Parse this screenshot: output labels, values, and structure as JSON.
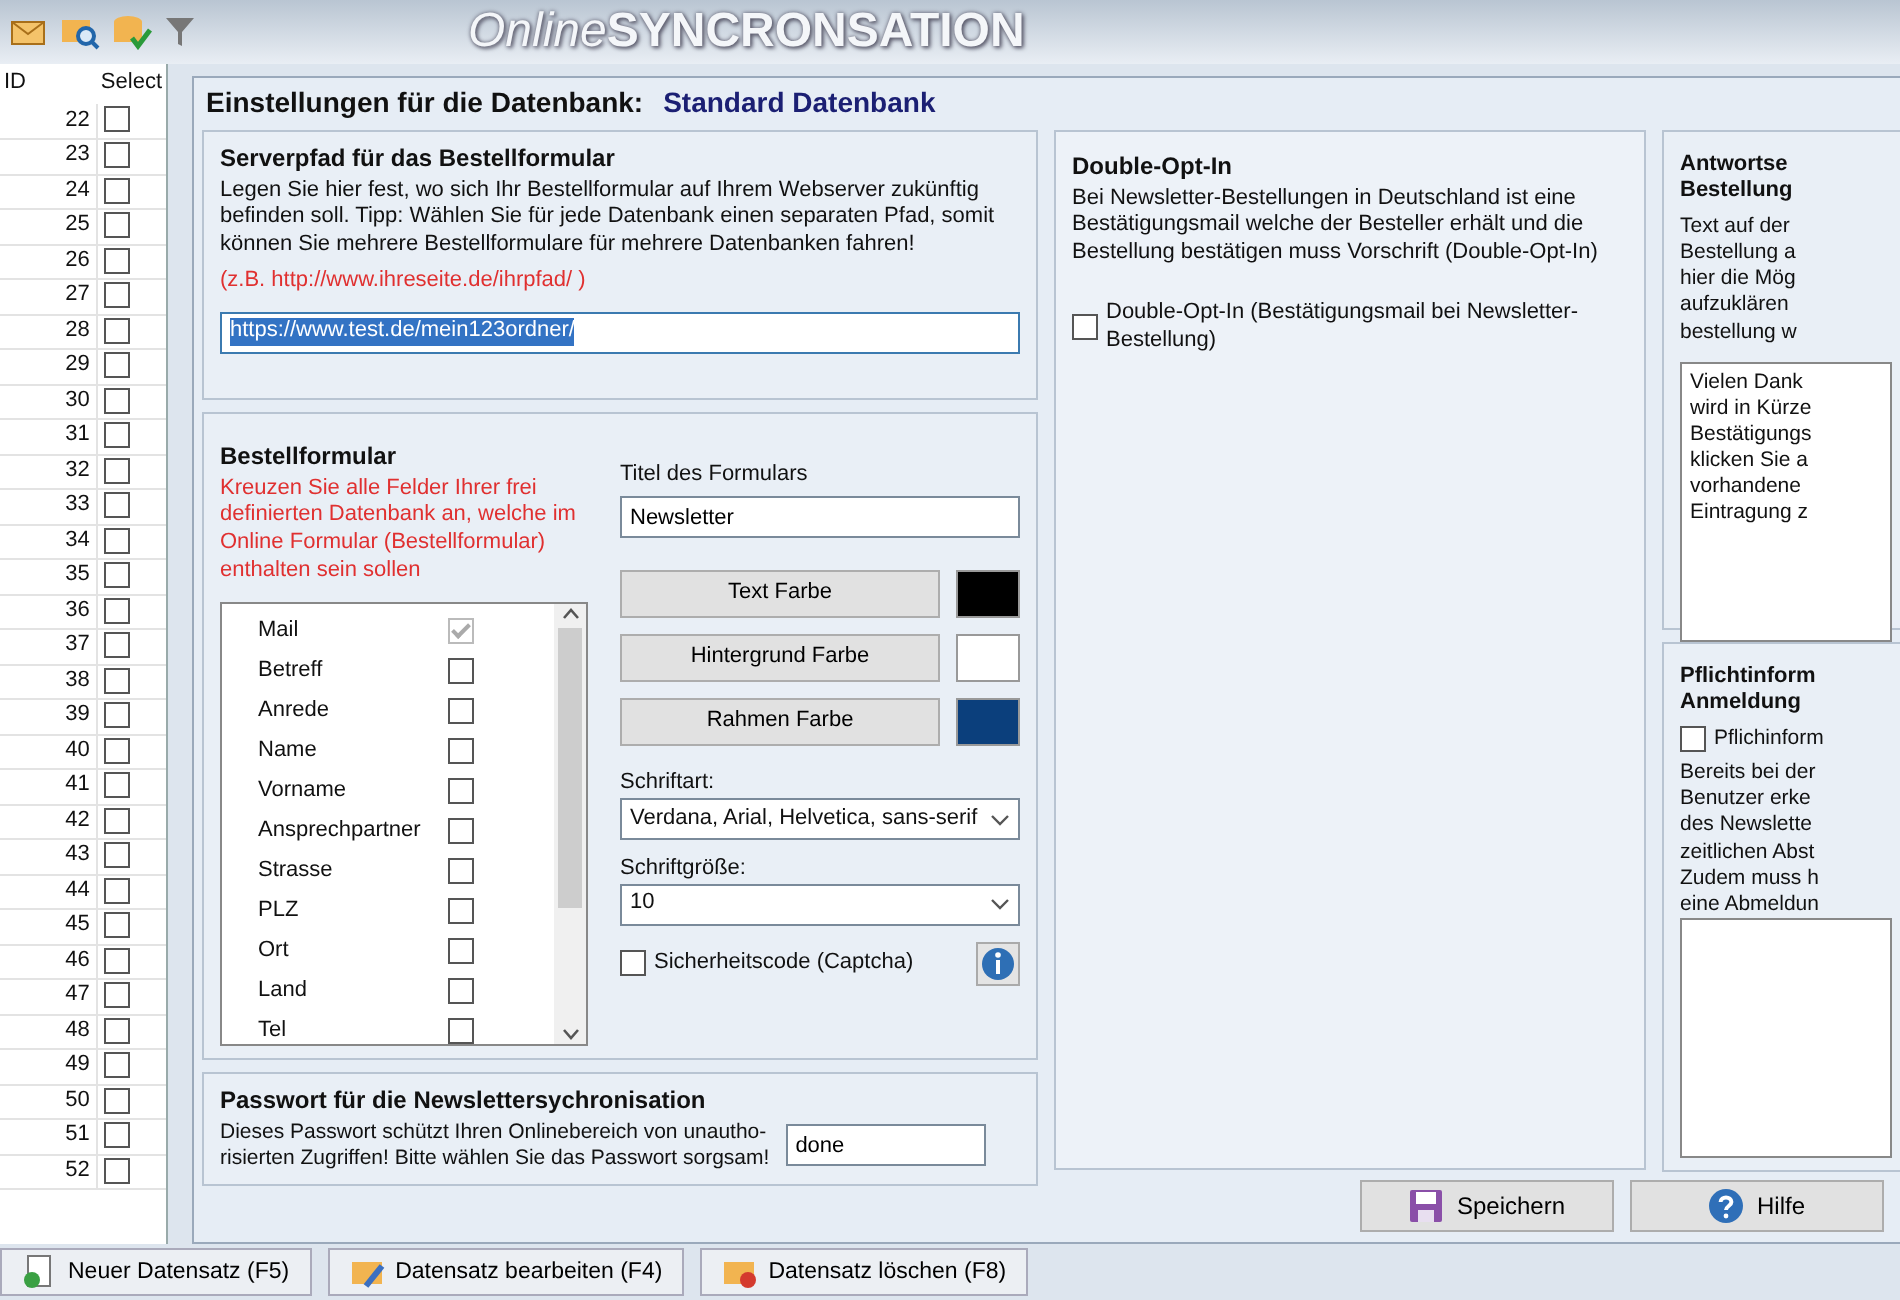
{
  "banner": {
    "logo_parts": [
      "Online",
      "SYNCRONSATION"
    ]
  },
  "records_table": {
    "columns": [
      "ID",
      "Select"
    ],
    "rows": [
      {
        "id": "22",
        "checked": false
      },
      {
        "id": "23",
        "checked": false
      },
      {
        "id": "24",
        "checked": false
      },
      {
        "id": "25",
        "checked": false
      },
      {
        "id": "26",
        "checked": false
      },
      {
        "id": "27",
        "checked": false
      },
      {
        "id": "28",
        "checked": false
      },
      {
        "id": "29",
        "checked": false
      },
      {
        "id": "30",
        "checked": false
      },
      {
        "id": "31",
        "checked": false
      },
      {
        "id": "32",
        "checked": false
      },
      {
        "id": "33",
        "checked": false
      },
      {
        "id": "34",
        "checked": false
      },
      {
        "id": "35",
        "checked": false
      },
      {
        "id": "36",
        "checked": false
      },
      {
        "id": "37",
        "checked": false
      },
      {
        "id": "38",
        "checked": false
      },
      {
        "id": "39",
        "checked": false
      },
      {
        "id": "40",
        "checked": false
      },
      {
        "id": "41",
        "checked": false
      },
      {
        "id": "42",
        "checked": false
      },
      {
        "id": "43",
        "checked": false
      },
      {
        "id": "44",
        "checked": false
      },
      {
        "id": "45",
        "checked": false
      },
      {
        "id": "46",
        "checked": false
      },
      {
        "id": "47",
        "checked": false
      },
      {
        "id": "48",
        "checked": false
      },
      {
        "id": "49",
        "checked": false
      },
      {
        "id": "50",
        "checked": false
      },
      {
        "id": "51",
        "checked": false
      },
      {
        "id": "52",
        "checked": false
      }
    ]
  },
  "dialog": {
    "title": "Einstellungen für die Datenbank:",
    "database": "Standard Datenbank",
    "server_path": {
      "heading": "Serverpfad für das Bestellformular",
      "description": "Legen Sie hier fest, wo sich Ihr Bestellformular auf Ihrem Webserver zukünftig befinden soll. Tipp: Wählen Sie für jede Datenbank einen separaten Pfad, somit können Sie mehrere Bestellformulare für mehrere Datenbanken fahren!",
      "example": "(z.B.  http://www.ihreseite.de/ihrpfad/ )",
      "value": "https://www.test.de/mein123ordner/",
      "text_selected": true
    },
    "order_form": {
      "heading": "Bestellformular",
      "instruction": "Kreuzen Sie alle Felder Ihrer frei definierten Datenbank an, welche im Online Formular (Bestellformular) enthalten sein sollen",
      "fields": [
        {
          "label": "Mail",
          "checked": true,
          "disabled": true
        },
        {
          "label": "Betreff",
          "checked": false,
          "disabled": false
        },
        {
          "label": "Anrede",
          "checked": false,
          "disabled": false
        },
        {
          "label": "Name",
          "checked": false,
          "disabled": false
        },
        {
          "label": "Vorname",
          "checked": false,
          "disabled": false
        },
        {
          "label": "Ansprechpartner",
          "checked": false,
          "disabled": false
        },
        {
          "label": "Strasse",
          "checked": false,
          "disabled": false
        },
        {
          "label": "PLZ",
          "checked": false,
          "disabled": false
        },
        {
          "label": "Ort",
          "checked": false,
          "disabled": false
        },
        {
          "label": "Land",
          "checked": false,
          "disabled": false
        },
        {
          "label": "Tel",
          "checked": false,
          "disabled": false
        }
      ],
      "form_title_label": "Titel des Formulars",
      "form_title_value": "Newsletter",
      "color_buttons": [
        {
          "label": "Text Farbe",
          "color": "#000000"
        },
        {
          "label": "Hintergrund Farbe",
          "color": "#ffffff"
        },
        {
          "label": "Rahmen Farbe",
          "color": "#0b3f7c"
        }
      ],
      "font_label": "Schriftart:",
      "font_value": "Verdana, Arial, Helvetica, sans-serif",
      "size_label": "Schriftgröße:",
      "size_value": "10",
      "captcha": {
        "label": "Sicherheitscode (Captcha)",
        "checked": false
      }
    },
    "password": {
      "heading": "Passwort für die Newslettersychronisation",
      "lines": [
        "Dieses Passwort schützt Ihren Onlinebereich von unautho-",
        "risierten Zugriffen! Bitte wählen Sie das Passwort sorgsam!"
      ],
      "value": "done"
    },
    "double_opt_in": {
      "heading": "Double-Opt-In",
      "lines": [
        "Bei Newsletter-Bestellungen in Deutschland ist eine",
        "Bestätigungsmail welche der Besteller erhält und die",
        "Bestellung bestätigen muss Vorschrift  (Double-Opt-In)"
      ],
      "checkbox": {
        "label": "Double-Opt-In (Bestätigungsmail bei Newsletter-Bestellung)",
        "checked": false
      }
    },
    "reply_page": {
      "heading_lines": [
        "Antwortse",
        "Bestellung"
      ],
      "description_lines": [
        "Text auf der",
        "Bestellung a",
        "hier die Mög",
        "aufzuklären",
        "bestellung w"
      ],
      "text_lines": [
        "Vielen Dank",
        "wird in Kürze",
        "Bestätigungs",
        "klicken Sie a",
        "vorhandene",
        "Eintragung z"
      ]
    },
    "mandatory_info": {
      "heading_lines": [
        "Pflichtinform",
        "Anmeldung"
      ],
      "checkbox": {
        "label": "Pflichinform",
        "checked": false
      },
      "description_lines": [
        "Bereits bei der",
        "Benutzer erke",
        "des Newslette",
        "zeitlichen Abst",
        "Zudem muss h",
        "eine Abmeldun"
      ]
    },
    "buttons": [
      {
        "kind": "save",
        "label": "Speichern"
      },
      {
        "kind": "help",
        "label": "Hilfe"
      }
    ]
  },
  "bottom_bar": {
    "buttons": [
      {
        "kind": "new",
        "label": "Neuer Datensatz (F5)"
      },
      {
        "kind": "edit",
        "label": "Datensatz bearbeiten (F4)"
      },
      {
        "kind": "delete",
        "label": "Datensatz löschen (F8)"
      }
    ]
  }
}
